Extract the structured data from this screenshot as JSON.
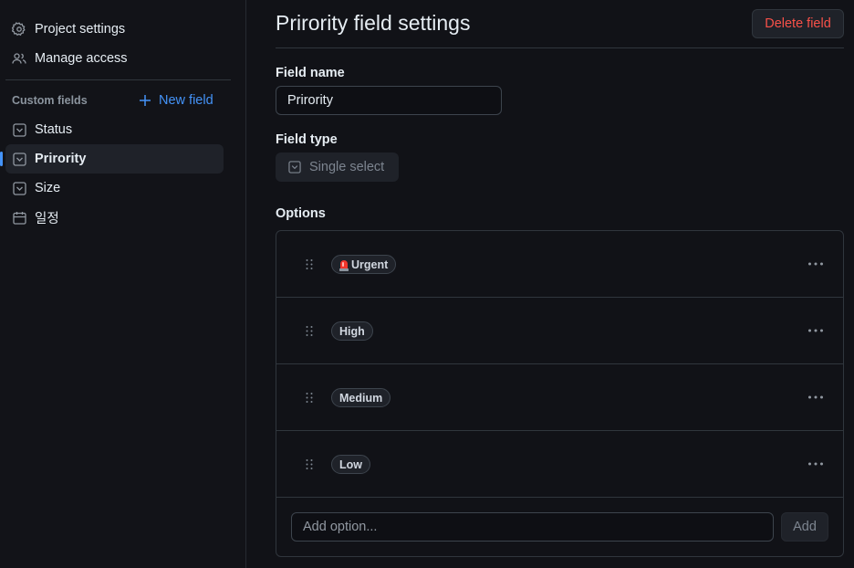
{
  "sidebar": {
    "top_items": [
      {
        "label": "Project settings",
        "icon": "gear-icon"
      },
      {
        "label": "Manage access",
        "icon": "people-icon"
      }
    ],
    "section_label": "Custom fields",
    "new_field_label": "New field",
    "fields": [
      {
        "label": "Status",
        "icon": "single-select-icon",
        "active": false
      },
      {
        "label": "Prirority",
        "icon": "single-select-icon",
        "active": true
      },
      {
        "label": "Size",
        "icon": "single-select-icon",
        "active": false
      },
      {
        "label": "일정",
        "icon": "calendar-icon",
        "active": false
      }
    ]
  },
  "main": {
    "title": "Prirority field settings",
    "delete_label": "Delete field",
    "field_name_label": "Field name",
    "field_name_value": "Prirority",
    "field_type_label": "Field type",
    "field_type_value": "Single select",
    "options_label": "Options",
    "options": [
      {
        "label": "Urgent",
        "emoji": "rotating-light-icon"
      },
      {
        "label": "High"
      },
      {
        "label": "Medium"
      },
      {
        "label": "Low"
      }
    ],
    "add_option_placeholder": "Add option...",
    "add_label": "Add"
  },
  "colors": {
    "background": "#111217",
    "accent": "#4493f8",
    "danger": "#f85149",
    "border": "#30363d",
    "muted": "#8b949e"
  }
}
